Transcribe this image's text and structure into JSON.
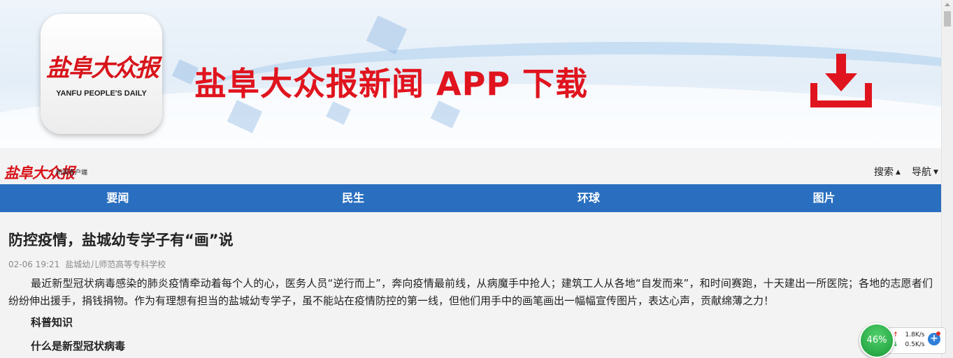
{
  "banner": {
    "logo_cn": "盐阜大众报",
    "logo_en": "YANFU PEOPLE'S DAILY",
    "title": "盐阜大众报新闻 APP 下载",
    "download_icon": "download-icon",
    "accent_color": "#e0141e"
  },
  "header": {
    "brand": "盐阜大众报",
    "brand_sub": "新闻客户端",
    "search_label": "搜索",
    "nav_label": "导航"
  },
  "nav": {
    "color": "#2a6fbf",
    "tabs": [
      {
        "label": "要闻"
      },
      {
        "label": "民生"
      },
      {
        "label": "环球"
      },
      {
        "label": "图片"
      }
    ]
  },
  "article": {
    "headline": "防控疫情，盐城幼专学子有“画”说",
    "date": "02-06 19:21",
    "source": "盐城幼儿师范高等专科学校",
    "paragraph": "最近新型冠状病毒感染的肺炎疫情牵动着每个人的心，医务人员“逆行而上”，奔向疫情最前线，从病魔手中抢人；建筑工人从各地“自发而来”，和时间赛跑，十天建出一所医院；各地的志愿者们纷纷伸出援手，捐钱捐物。作为有理想有担当的盐城幼专学子，虽不能站在疫情防控的第一线，但他们用手中的画笔画出一幅幅宣传图片，表达心声，贡献绵薄之力！",
    "subheading1": "科普知识",
    "subheading2": "什么是新型冠状病毒"
  },
  "speed_widget": {
    "percent": "46%",
    "upload": "1.8K/s",
    "download": "0.5K/s",
    "up_arrow": "↑",
    "down_arrow": "↓",
    "plus": "+"
  }
}
